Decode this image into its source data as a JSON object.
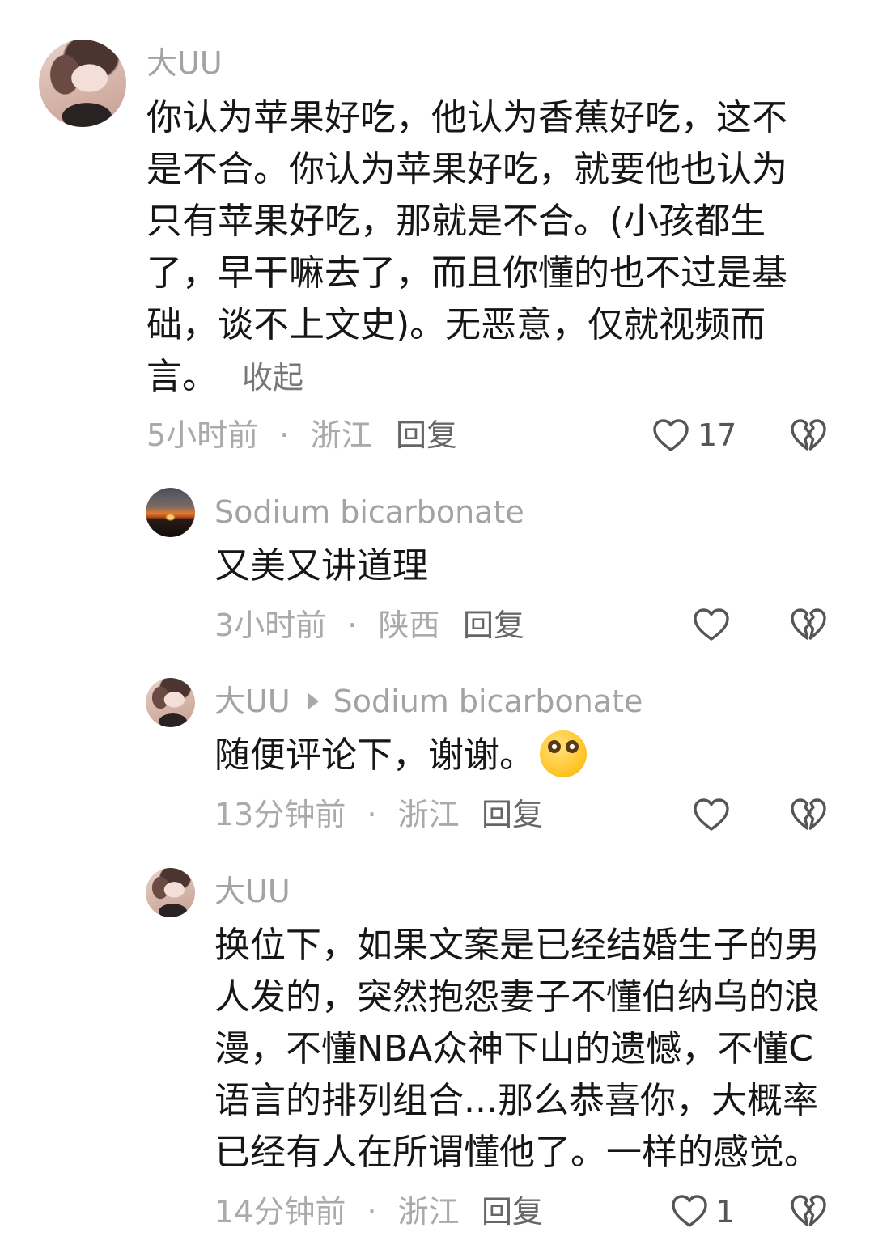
{
  "comment_main": {
    "author": "大UU",
    "text": "你认为苹果好吃，他认为香蕉好吃，这不是不合。你认为苹果好吃，就要他也认为只有苹果好吃，那就是不合。(小孩都生了，早干嘛去了，而且你懂的也不过是基础，谈不上文史)。无恶意，仅就视频而言。",
    "collapse_label": "收起",
    "time": "5小时前",
    "location": "浙江",
    "reply_label": "回复",
    "likes": "17"
  },
  "replies": [
    {
      "author": "Sodium bicarbonate",
      "text": "又美又讲道理",
      "time": "3小时前",
      "location": "陕西",
      "reply_label": "回复"
    },
    {
      "author": "大UU",
      "reply_to": "Sodium bicarbonate",
      "text": "随便评论下，谢谢。",
      "emoji": "pleading-face-emoji",
      "time": "13分钟前",
      "location": "浙江",
      "reply_label": "回复"
    },
    {
      "author": "大UU",
      "text": "换位下，如果文案是已经结婚生子的男人发的，突然抱怨妻子不懂伯纳乌的浪漫，不懂NBA众神下山的遗憾，不懂C语言的排列组合...那么恭喜你，大概率已经有人在所谓懂他了。一样的感觉。",
      "time": "14分钟前",
      "location": "浙江",
      "reply_label": "回复",
      "likes": "1"
    }
  ],
  "separator": "·",
  "icons": {
    "like": "heart-outline-icon",
    "dislike": "broken-heart-icon",
    "reply_arrow": "triangle-right-icon"
  }
}
